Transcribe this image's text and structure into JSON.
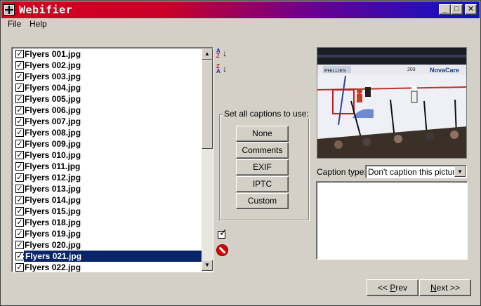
{
  "window": {
    "title": "Webifier"
  },
  "menu": {
    "file": "File",
    "help": "Help"
  },
  "files": [
    {
      "name": "Flyers 001.jpg",
      "checked": true
    },
    {
      "name": "Flyers 002.jpg",
      "checked": true
    },
    {
      "name": "Flyers 003.jpg",
      "checked": true
    },
    {
      "name": "Flyers 004.jpg",
      "checked": true
    },
    {
      "name": "Flyers 005.jpg",
      "checked": true
    },
    {
      "name": "Flyers 006.jpg",
      "checked": true
    },
    {
      "name": "Flyers 007.jpg",
      "checked": true
    },
    {
      "name": "Flyers 008.jpg",
      "checked": true
    },
    {
      "name": "Flyers 009.jpg",
      "checked": true
    },
    {
      "name": "Flyers 010.jpg",
      "checked": true
    },
    {
      "name": "Flyers 011.jpg",
      "checked": true
    },
    {
      "name": "Flyers 012.jpg",
      "checked": true
    },
    {
      "name": "Flyers 013.jpg",
      "checked": true
    },
    {
      "name": "Flyers 014.jpg",
      "checked": true
    },
    {
      "name": "Flyers 015.jpg",
      "checked": true
    },
    {
      "name": "Flyers 018.jpg",
      "checked": true
    },
    {
      "name": "Flyers 019.jpg",
      "checked": true
    },
    {
      "name": "Flyers 020.jpg",
      "checked": true
    },
    {
      "name": "Flyers 021.jpg",
      "checked": true,
      "selected": true
    },
    {
      "name": "Flyers 022.jpg",
      "checked": true
    }
  ],
  "sort": {
    "az": [
      "A",
      "Z"
    ],
    "za": [
      "Z",
      "A"
    ]
  },
  "captions_group": {
    "legend": "Set all captions to use:",
    "buttons": [
      "None",
      "Comments",
      "EXIF",
      "IPTC",
      "Custom"
    ]
  },
  "caption_type": {
    "label": "Caption type:",
    "selected": "Don't caption this picture"
  },
  "photo": {
    "boards_text": [
      "PHILLIES",
      "203",
      "NovaCare"
    ]
  },
  "nav": {
    "prev_prefix": "<< ",
    "prev_mnemonic": "P",
    "prev_rest": "rev",
    "next_mnemonic": "N",
    "next_rest": "ext >>"
  },
  "icons": {
    "app": "app-grid-icon",
    "sort_asc": "sort-az-icon",
    "sort_desc": "sort-za-icon",
    "check_all": "check-all-icon",
    "uncheck_all": "no-entry-icon"
  }
}
